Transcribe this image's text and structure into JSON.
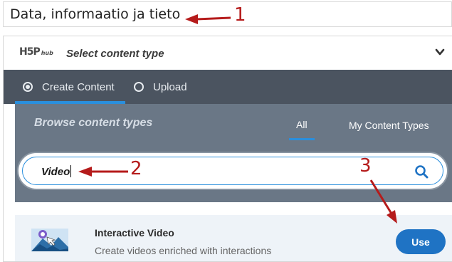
{
  "title_field": {
    "value": "Data, informaatio ja tieto"
  },
  "hub": {
    "logo": {
      "main": "H5P",
      "sub": "hub"
    },
    "header_title": "Select content type",
    "tabs": [
      {
        "label": "Create Content",
        "selected": true
      },
      {
        "label": "Upload",
        "selected": false
      }
    ],
    "browse_label": "Browse content types",
    "filters": {
      "all": "All",
      "my": "My Content Types"
    },
    "search": {
      "value": "Video"
    },
    "results": [
      {
        "title": "Interactive Video",
        "description": "Create videos enriched with interactions",
        "button": "Use"
      }
    ]
  },
  "annotations": {
    "one": "1",
    "two": "2",
    "three": "3"
  },
  "colors": {
    "annotation": "#b51b1b",
    "tabs_bg": "#4b5460",
    "browse_bg": "#6a7786",
    "accent": "#2a8fdd",
    "use_button": "#1f73c4"
  }
}
